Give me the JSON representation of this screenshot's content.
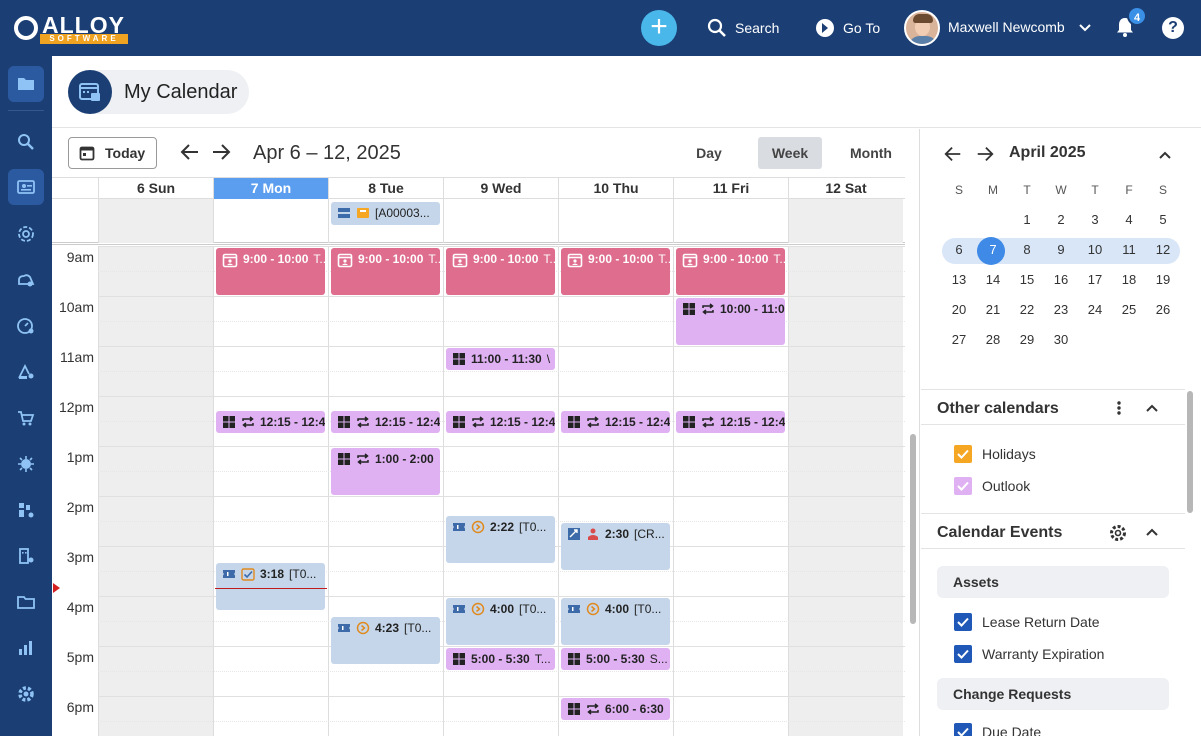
{
  "topbar": {
    "logo_word": "ALLOY",
    "logo_sub": "SOFTWARE",
    "search_label": "Search",
    "goto_label": "Go To",
    "user_name": "Maxwell Newcomb",
    "notifications": "4",
    "help": "?",
    "plus": "+"
  },
  "page": {
    "title": "My Calendar"
  },
  "toolbar": {
    "today_label": "Today",
    "range": "Apr 6 – 12, 2025",
    "views": [
      "Day",
      "Week",
      "Month"
    ],
    "selected_view": "Week"
  },
  "days": [
    {
      "label": "6 Sun"
    },
    {
      "label": "7 Mon"
    },
    {
      "label": "8 Tue"
    },
    {
      "label": "9 Wed"
    },
    {
      "label": "10 Thu"
    },
    {
      "label": "11 Fri"
    },
    {
      "label": "12 Sat"
    }
  ],
  "hours": [
    "9am",
    "10am",
    "11am",
    "12pm",
    "1pm",
    "2pm",
    "3pm",
    "4pm",
    "5pm",
    "6pm"
  ],
  "allday_event": {
    "label": "[A00003..."
  },
  "events": [
    {
      "day": 1,
      "start": "9:00",
      "end": "10:00",
      "color": "pink",
      "icon": "calendar-person",
      "time": "9:00 - 10:00",
      "text": "T..."
    },
    {
      "day": 2,
      "start": "9:00",
      "end": "10:00",
      "color": "pink",
      "icon": "calendar-person",
      "time": "9:00 - 10:00",
      "text": "T..."
    },
    {
      "day": 3,
      "start": "9:00",
      "end": "10:00",
      "color": "pink",
      "icon": "calendar-person",
      "time": "9:00 - 10:00",
      "text": "T..."
    },
    {
      "day": 4,
      "start": "9:00",
      "end": "10:00",
      "color": "pink",
      "icon": "calendar-person",
      "time": "9:00 - 10:00",
      "text": "T..."
    },
    {
      "day": 5,
      "start": "9:00",
      "end": "10:00",
      "color": "pink",
      "icon": "calendar-person",
      "time": "9:00 - 10:00",
      "text": "T..."
    },
    {
      "day": 5,
      "start": "10:00",
      "end": "11:00",
      "color": "violet",
      "icon": "windows-repeat",
      "time": "10:00 - 11:0",
      "text": ""
    },
    {
      "day": 3,
      "start": "11:00",
      "end": "11:30",
      "color": "violet",
      "icon": "windows",
      "time": "11:00 - 11:30",
      "text": "\\"
    },
    {
      "day": 1,
      "start": "12:15",
      "end": "12:45",
      "color": "violet",
      "icon": "windows-repeat",
      "time": "12:15 - 12:4",
      "text": ""
    },
    {
      "day": 2,
      "start": "12:15",
      "end": "12:45",
      "color": "violet",
      "icon": "windows-repeat",
      "time": "12:15 - 12:4",
      "text": ""
    },
    {
      "day": 3,
      "start": "12:15",
      "end": "12:45",
      "color": "violet",
      "icon": "windows-repeat",
      "time": "12:15 - 12:4",
      "text": ""
    },
    {
      "day": 4,
      "start": "12:15",
      "end": "12:45",
      "color": "violet",
      "icon": "windows-repeat",
      "time": "12:15 - 12:4",
      "text": ""
    },
    {
      "day": 5,
      "start": "12:15",
      "end": "12:45",
      "color": "violet",
      "icon": "windows-repeat",
      "time": "12:15 - 12:4",
      "text": ""
    },
    {
      "day": 2,
      "start": "13:00",
      "end": "14:00",
      "color": "violet",
      "icon": "windows-repeat",
      "time": "1:00 - 2:00",
      "text": ""
    },
    {
      "day": 3,
      "start": "14:22",
      "end": "15:22",
      "color": "blue",
      "icon": "ticket-clock",
      "time": "2:22",
      "text": "[T0..."
    },
    {
      "day": 4,
      "start": "14:30",
      "end": "15:30",
      "color": "blue",
      "icon": "change-person",
      "time": "2:30",
      "text": "[CR..."
    },
    {
      "day": 1,
      "start": "15:18",
      "end": "16:18",
      "color": "blue",
      "icon": "ticket-check",
      "time": "3:18",
      "text": "[T0..."
    },
    {
      "day": 3,
      "start": "16:00",
      "end": "17:00",
      "color": "blue",
      "icon": "ticket-clock",
      "time": "4:00",
      "text": "[T0..."
    },
    {
      "day": 4,
      "start": "16:00",
      "end": "17:00",
      "color": "blue",
      "icon": "ticket-clock",
      "time": "4:00",
      "text": "[T0..."
    },
    {
      "day": 2,
      "start": "16:23",
      "end": "17:23",
      "color": "blue",
      "icon": "ticket-clock",
      "time": "4:23",
      "text": "[T0..."
    },
    {
      "day": 3,
      "start": "17:00",
      "end": "17:30",
      "color": "violet",
      "icon": "windows",
      "time": "5:00 - 5:30",
      "text": "T..."
    },
    {
      "day": 4,
      "start": "17:00",
      "end": "17:30",
      "color": "violet",
      "icon": "windows",
      "time": "5:00 - 5:30",
      "text": "S..."
    },
    {
      "day": 4,
      "start": "18:00",
      "end": "18:30",
      "color": "violet",
      "icon": "windows-repeat",
      "time": "6:00 - 6:30",
      "text": ""
    }
  ],
  "now_time": "15:50",
  "mini_calendar": {
    "title": "April 2025",
    "dow": [
      "S",
      "M",
      "T",
      "W",
      "T",
      "F",
      "S"
    ],
    "weeks": [
      [
        "",
        "",
        "1",
        "2",
        "3",
        "4",
        "5"
      ],
      [
        "6",
        "7",
        "8",
        "9",
        "10",
        "11",
        "12"
      ],
      [
        "13",
        "14",
        "15",
        "16",
        "17",
        "18",
        "19"
      ],
      [
        "20",
        "21",
        "22",
        "23",
        "24",
        "25",
        "26"
      ],
      [
        "27",
        "28",
        "29",
        "30",
        "",
        "",
        ""
      ]
    ],
    "today": "7"
  },
  "other_calendars": {
    "title": "Other calendars",
    "items": [
      {
        "label": "Holidays",
        "color": "#f5a623"
      },
      {
        "label": "Outlook",
        "color": "#dfb1f3"
      }
    ]
  },
  "calendar_events": {
    "title": "Calendar Events",
    "groups": [
      {
        "name": "Assets",
        "items": [
          "Lease Return Date",
          "Warranty Expiration"
        ]
      },
      {
        "name": "Change Requests",
        "items": [
          "Due Date"
        ]
      }
    ]
  },
  "colors": {
    "brand": "#1b3f74",
    "accent": "#3f8ae6",
    "pink": "#de6d8e",
    "violet": "#dfb1f3",
    "blue": "#c5d6ea"
  }
}
